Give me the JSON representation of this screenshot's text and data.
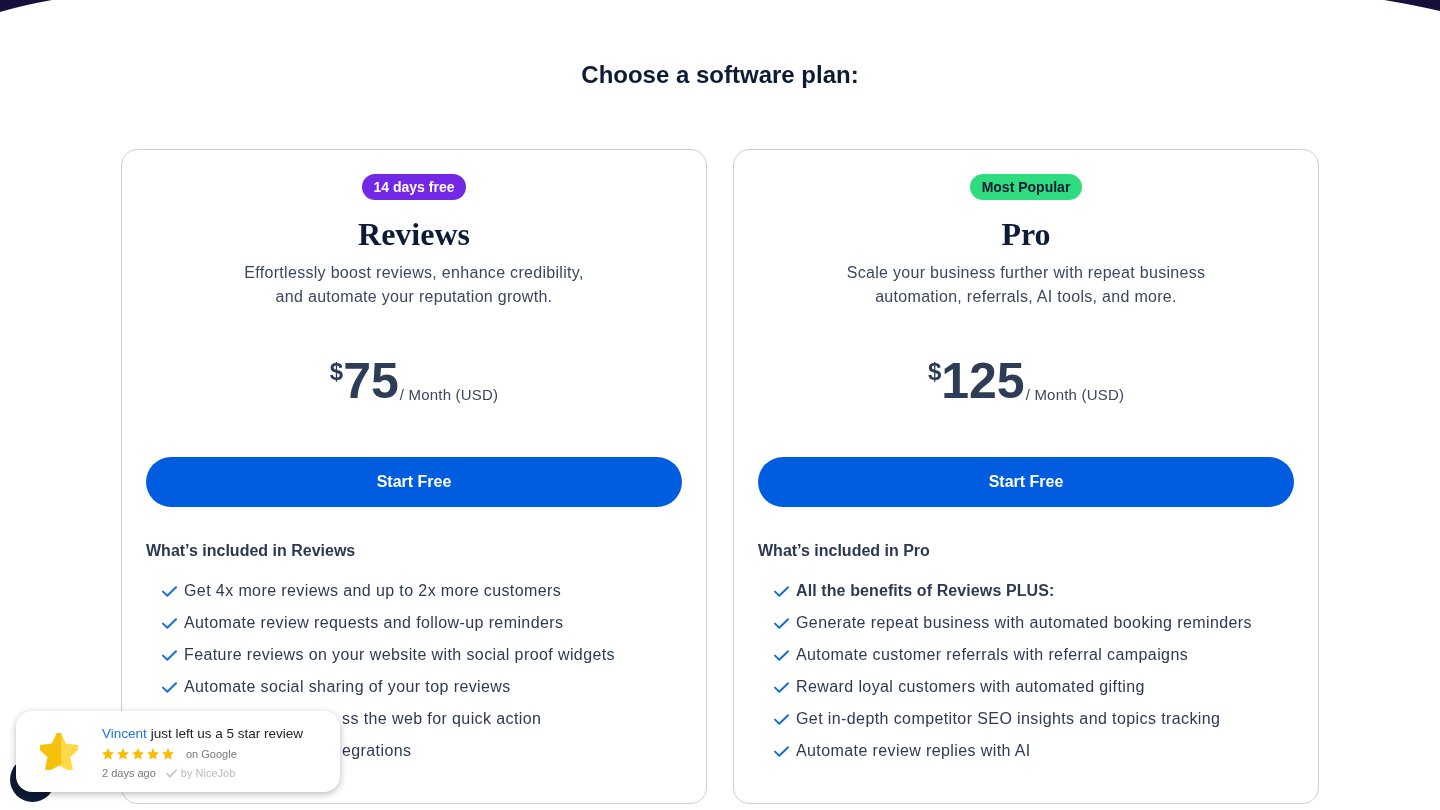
{
  "page": {
    "title": "Choose a software plan:"
  },
  "plans": [
    {
      "badge": {
        "label": "14 days free",
        "color": "#7328e6"
      },
      "name": "Reviews",
      "description": "Effortlessly boost reviews, enhance credibility,\nand automate your reputation growth.",
      "price": {
        "currency": "$",
        "amount": "75",
        "period": "/ Month (USD)"
      },
      "button": "Start Free",
      "features_title": "What’s included in Reviews",
      "features": [
        {
          "kind": "feature",
          "text": "Get 4x more reviews and up to 2x more customers"
        },
        {
          "kind": "feature",
          "text": "Automate review requests and follow-up reminders"
        },
        {
          "kind": "feature",
          "text": "Feature reviews on your website with social proof widgets"
        },
        {
          "kind": "feature",
          "text": "Automate social sharing of your top reviews"
        },
        {
          "kind": "covered",
          "text": "ss the web for quick action"
        },
        {
          "kind": "covered",
          "text": "egrations"
        }
      ]
    },
    {
      "badge": {
        "label": "Most Popular",
        "color": "#2fdc80"
      },
      "name": "Pro",
      "description": "Scale your business further with repeat business\nautomation, referrals, AI tools, and more.",
      "price": {
        "currency": "$",
        "amount": "125",
        "period": "/ Month (USD)"
      },
      "button": "Start Free",
      "features_title": "What’s included in Pro",
      "features": [
        {
          "kind": "summary",
          "text": "All the benefits of Reviews PLUS:"
        },
        {
          "kind": "feature",
          "text": "Generate repeat business with automated booking reminders"
        },
        {
          "kind": "feature",
          "text": "Automate customer referrals with referral campaigns"
        },
        {
          "kind": "feature",
          "text": "Reward loyal customers with automated gifting"
        },
        {
          "kind": "feature",
          "text": "Get in-depth competitor SEO insights and topics tracking"
        },
        {
          "kind": "feature",
          "text": "Automate review replies with AI"
        }
      ]
    }
  ],
  "notification": {
    "reviewer": "Vincent",
    "message": "just left us a 5 star review",
    "stars": 5,
    "source": "on Google",
    "time": "2 days ago",
    "attribution": "by NiceJob"
  }
}
